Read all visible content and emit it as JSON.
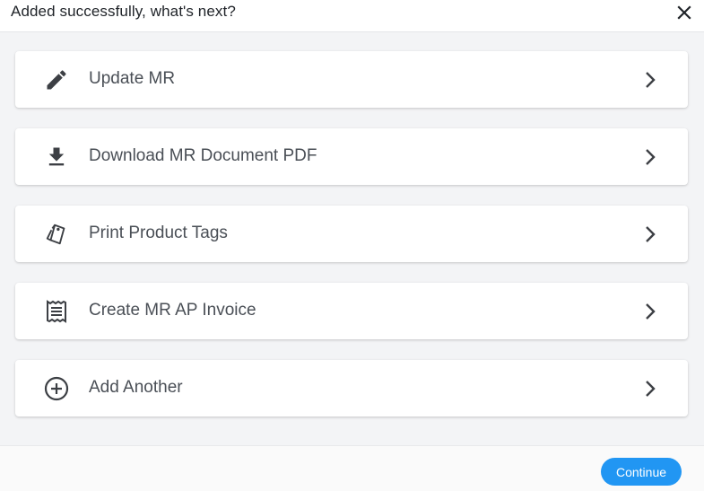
{
  "dialog": {
    "title": "Added successfully, what's next?",
    "close_icon": "close-icon"
  },
  "actions": [
    {
      "label": "Update MR",
      "icon": "pencil-icon"
    },
    {
      "label": "Download MR Document PDF",
      "icon": "download-icon"
    },
    {
      "label": "Print Product Tags",
      "icon": "tags-icon"
    },
    {
      "label": "Create MR AP Invoice",
      "icon": "receipt-icon"
    },
    {
      "label": "Add Another",
      "icon": "add-circle-icon"
    }
  ],
  "footer": {
    "continue_label": "Continue"
  },
  "colors": {
    "accent": "#2196f3",
    "icon": "#3c3f44",
    "background": "#f3f4f6"
  }
}
